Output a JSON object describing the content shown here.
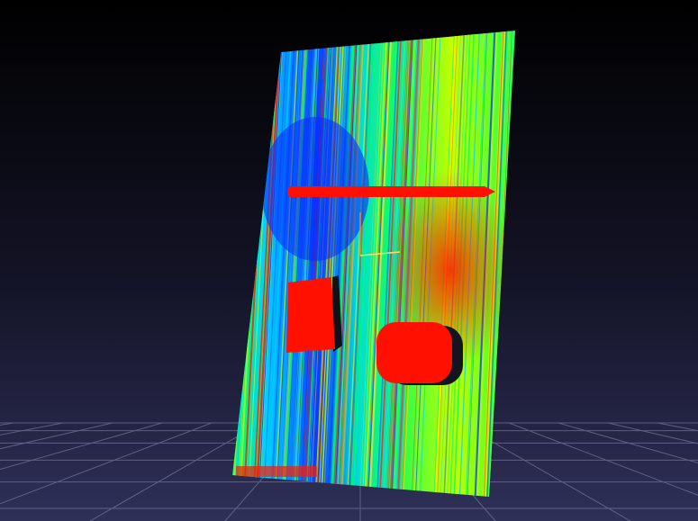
{
  "viewer": {
    "background": {
      "top": "#000000",
      "bottom": "#2f3058"
    },
    "grid": {
      "visible": true,
      "color": "#8a8cb0"
    },
    "point_cloud": {
      "color_map": [
        "#0022ff",
        "#00d0ff",
        "#00ff66",
        "#b8ff00",
        "#ffee00",
        "#ff1a00"
      ],
      "red_objects": [
        "horizontal-bar",
        "left-block",
        "rounded-square-block"
      ],
      "axis_gizmo_colors": {
        "x": "#ff7a1a",
        "y": "#ffdd66"
      }
    }
  }
}
